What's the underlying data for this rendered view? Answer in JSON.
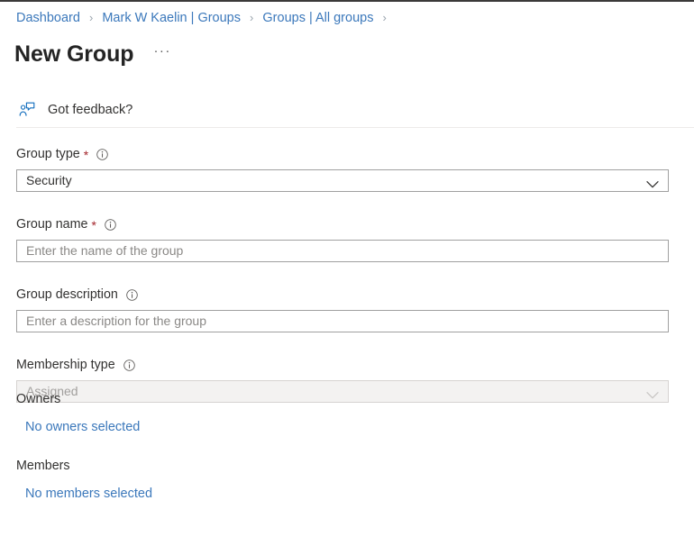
{
  "breadcrumb": {
    "separator": "›",
    "items": [
      {
        "label": "Dashboard"
      },
      {
        "label": "Mark W Kaelin | Groups"
      },
      {
        "label": "Groups | All groups"
      }
    ]
  },
  "header": {
    "title": "New Group",
    "more_menu": "···"
  },
  "feedback": {
    "label": "Got feedback?",
    "icon": "feedback-person-icon",
    "icon_color": "#0f6cbd"
  },
  "form": {
    "required_marker": "*",
    "info_icon": "info-icon",
    "chevron_icon": "chevron-down-icon",
    "fields": [
      {
        "key": "group_type",
        "label": "Group type",
        "required": true,
        "has_info": true,
        "type": "dropdown",
        "value": "Security",
        "disabled": false
      },
      {
        "key": "group_name",
        "label": "Group name",
        "required": true,
        "has_info": true,
        "type": "text",
        "value": "",
        "placeholder": "Enter the name of the group",
        "disabled": false
      },
      {
        "key": "group_description",
        "label": "Group description",
        "required": false,
        "has_info": true,
        "type": "text",
        "value": "",
        "placeholder": "Enter a description for the group",
        "disabled": false
      },
      {
        "key": "membership_type",
        "label": "Membership type",
        "required": false,
        "has_info": true,
        "type": "dropdown",
        "value": "Assigned",
        "disabled": true
      }
    ]
  },
  "people": {
    "owners": {
      "label": "Owners",
      "link": "No owners selected"
    },
    "members": {
      "label": "Members",
      "link": "No members selected"
    }
  },
  "colors": {
    "link": "#3b78bb",
    "required": "#a4262c",
    "text": "#323130",
    "placeholder": "#8a8886",
    "disabled_bg": "#f3f2f1",
    "border": "#a0a0a0",
    "divider": "#edebe9",
    "accent": "#0f6cbd"
  }
}
